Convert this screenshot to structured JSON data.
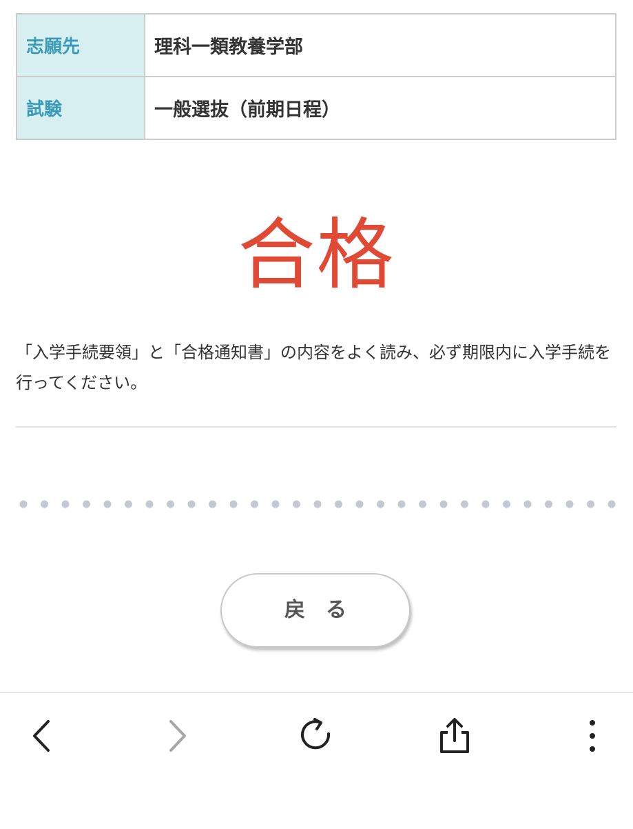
{
  "info": {
    "rows": [
      {
        "label": "志願先",
        "value": "理科一類教養学部"
      },
      {
        "label": "試験",
        "value": "一般選抜（前期日程）"
      }
    ]
  },
  "result": {
    "text": "合格",
    "color": "#e04a34"
  },
  "message": {
    "text": "「入学手続要領」と「合格通知書」の内容をよく読み、必ず期限内に入学手続を行ってください。"
  },
  "back_button": {
    "label": "戻　る"
  },
  "browser_toolbar": {
    "icons": [
      "back-arrow-icon",
      "forward-arrow-icon",
      "reload-icon",
      "share-icon",
      "more-vertical-icon"
    ]
  },
  "colors": {
    "label_background": "#d8eff1",
    "label_text": "#3a9bb9",
    "result_red": "#e04a34"
  }
}
